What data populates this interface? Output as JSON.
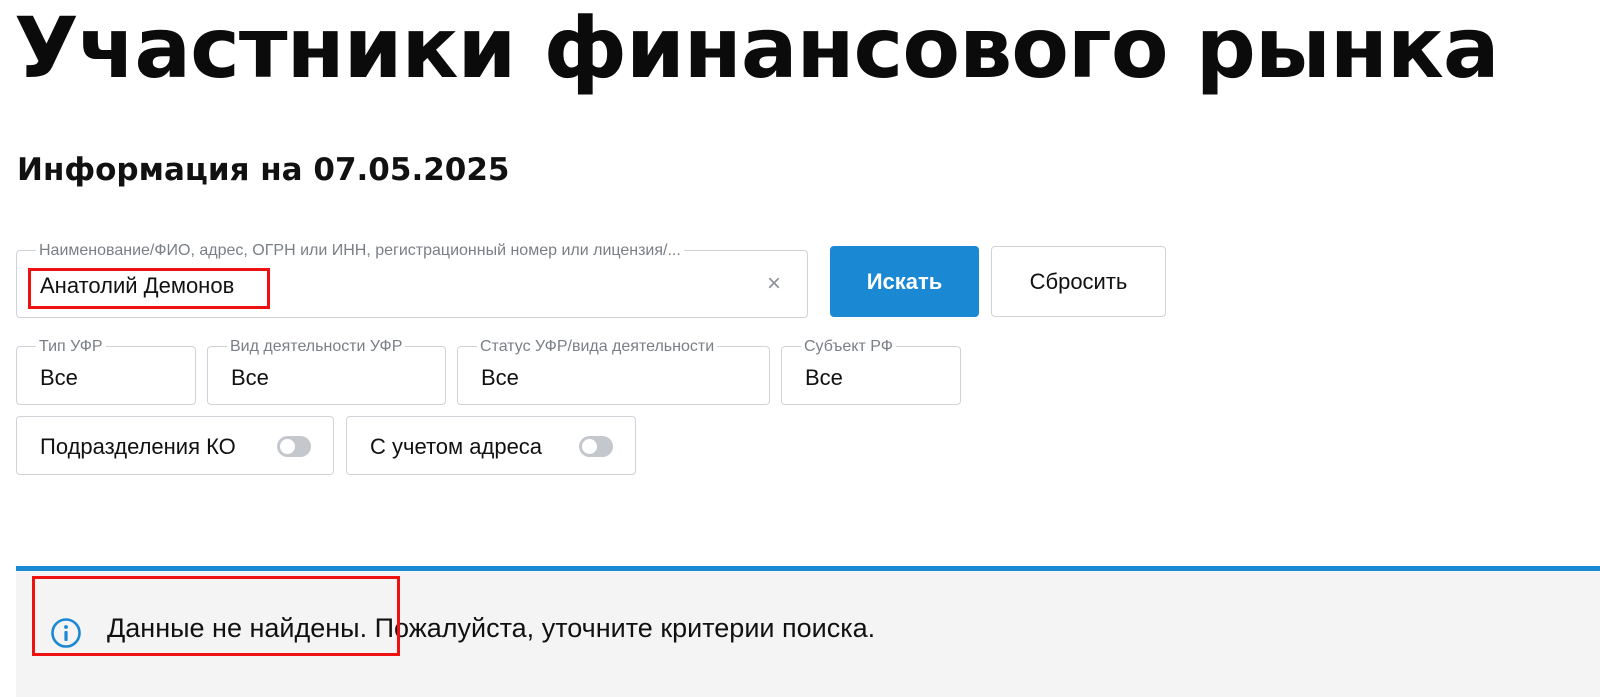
{
  "header": {
    "title": "Участники финансового рынка",
    "info_date": "Информация на 07.05.2025"
  },
  "search": {
    "label": "Наименование/ФИО, адрес, ОГРН или ИНН, регистрационный номер или лицензия/...",
    "value": "Анатолий Демонов",
    "clear_glyph": "×",
    "search_button": "Искать",
    "reset_button": "Сбросить"
  },
  "filters": {
    "type": {
      "label": "Тип УФР",
      "value": "Все"
    },
    "kind": {
      "label": "Вид деятельности УФР",
      "value": "Все"
    },
    "status": {
      "label": "Статус УФР/вида деятельности",
      "value": "Все"
    },
    "region": {
      "label": "Субъект РФ",
      "value": "Все"
    }
  },
  "toggles": {
    "ko_divisions": {
      "label": "Подразделения КО",
      "on": false
    },
    "with_address": {
      "label": "С учетом адреса",
      "on": false
    }
  },
  "notice": {
    "icon": "info-icon",
    "text": "Данные не найдены. Пожалуйста, уточните критерии поиска."
  },
  "colors": {
    "accent": "#1a88d2",
    "highlight": "#ee1111",
    "notice_bg": "#f4f4f4"
  }
}
